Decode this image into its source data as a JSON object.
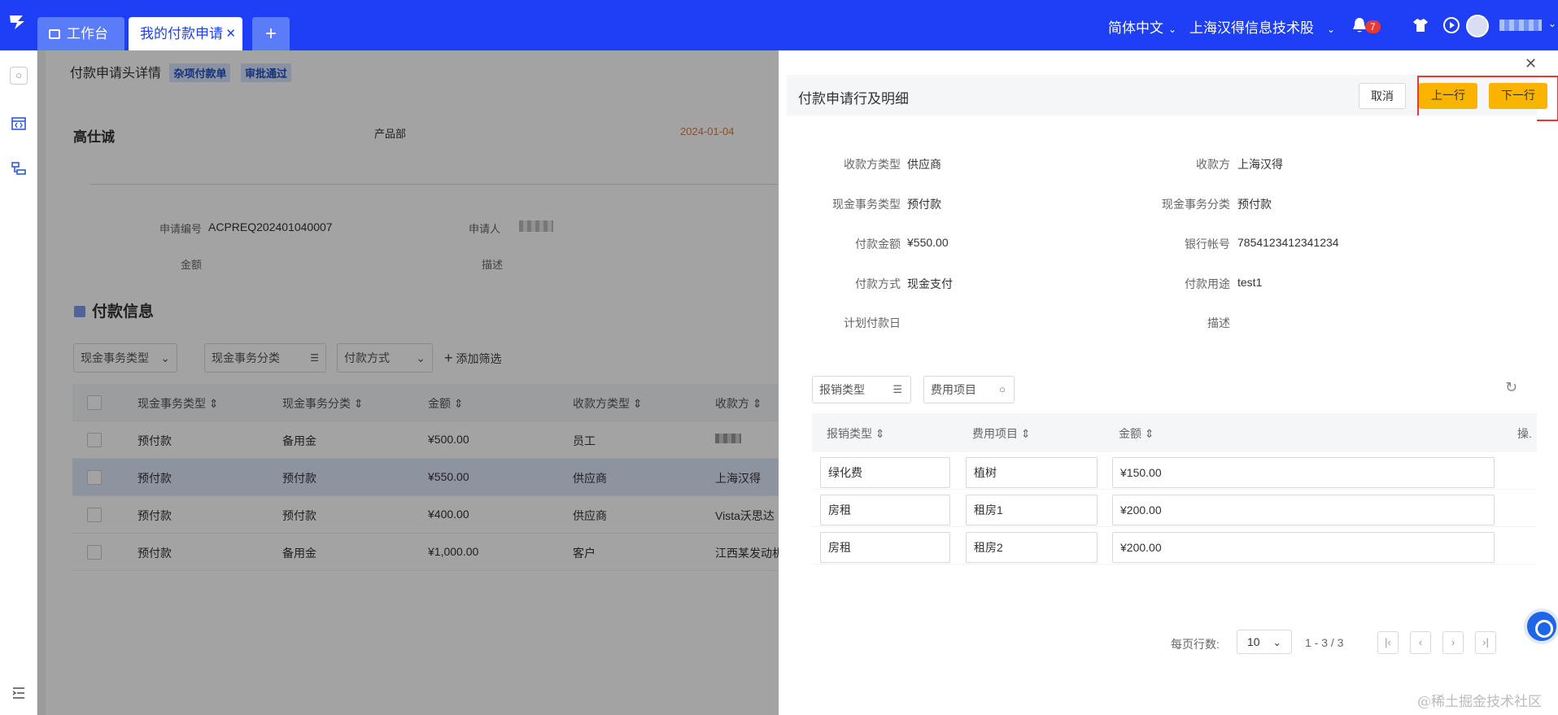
{
  "topbar": {
    "tabs": [
      {
        "label": "工作台"
      },
      {
        "label": "我的付款申请"
      }
    ],
    "language": "简体中文",
    "company": "上海汉得信息技术股",
    "notification_count": "7"
  },
  "background_page": {
    "title": "付款申请头详情",
    "tags": [
      "杂项付款单",
      "审批通过"
    ],
    "applicant_name": "高仕诚",
    "department": "产品部",
    "date": "2024-01-04",
    "fields": {
      "apply_no_label": "申请编号",
      "apply_no_value": "ACPREQ202401040007",
      "applicant_label": "申请人",
      "amount_label": "金额",
      "desc_label": "描述"
    },
    "section_title": "付款信息",
    "filters": [
      "现金事务类型",
      "现金事务分类",
      "付款方式",
      "添加筛选"
    ],
    "table": {
      "columns": [
        "现金事务类型",
        "现金事务分类",
        "金额",
        "收款方类型",
        "收款方"
      ],
      "rows": [
        [
          "预付款",
          "备用金",
          "¥500.00",
          "员工",
          ""
        ],
        [
          "预付款",
          "预付款",
          "¥550.00",
          "供应商",
          "上海汉得"
        ],
        [
          "预付款",
          "预付款",
          "¥400.00",
          "供应商",
          "Vista沃思达"
        ],
        [
          "预付款",
          "备用金",
          "¥1,000.00",
          "客户",
          "江西某发动机"
        ]
      ]
    }
  },
  "drawer": {
    "title": "付款申请行及明细",
    "buttons": {
      "cancel": "取消",
      "prev": "上一行",
      "next": "下一行"
    },
    "fields": [
      {
        "label": "收款方类型",
        "value": "供应商"
      },
      {
        "label": "收款方",
        "value": "上海汉得"
      },
      {
        "label": "现金事务类型",
        "value": "预付款"
      },
      {
        "label": "现金事务分类",
        "value": "预付款"
      },
      {
        "label": "付款金额",
        "value": "¥550.00"
      },
      {
        "label": "银行帐号",
        "value": "7854123412341234"
      },
      {
        "label": "付款方式",
        "value": "现金支付"
      },
      {
        "label": "付款用途",
        "value": "test1"
      },
      {
        "label": "计划付款日",
        "value": ""
      },
      {
        "label": "描述",
        "value": ""
      }
    ],
    "filters": {
      "expense_type": "报销类型",
      "expense_item": "费用项目"
    },
    "table": {
      "columns": [
        "报销类型",
        "费用项目",
        "金额",
        "操."
      ],
      "rows": [
        [
          "绿化费",
          "植树",
          "¥150.00"
        ],
        [
          "房租",
          "租房1",
          "¥200.00"
        ],
        [
          "房租",
          "租房2",
          "¥200.00"
        ]
      ]
    },
    "pagination": {
      "label": "每页行数:",
      "page_size": "10",
      "range": "1 - 3 / 3"
    }
  },
  "watermark": "@稀土掘金技术社区",
  "colors": {
    "brand": "#1e3ff5",
    "accent_button": "#f8b400",
    "highlight": "#e53935",
    "date": "#e07a3c"
  }
}
